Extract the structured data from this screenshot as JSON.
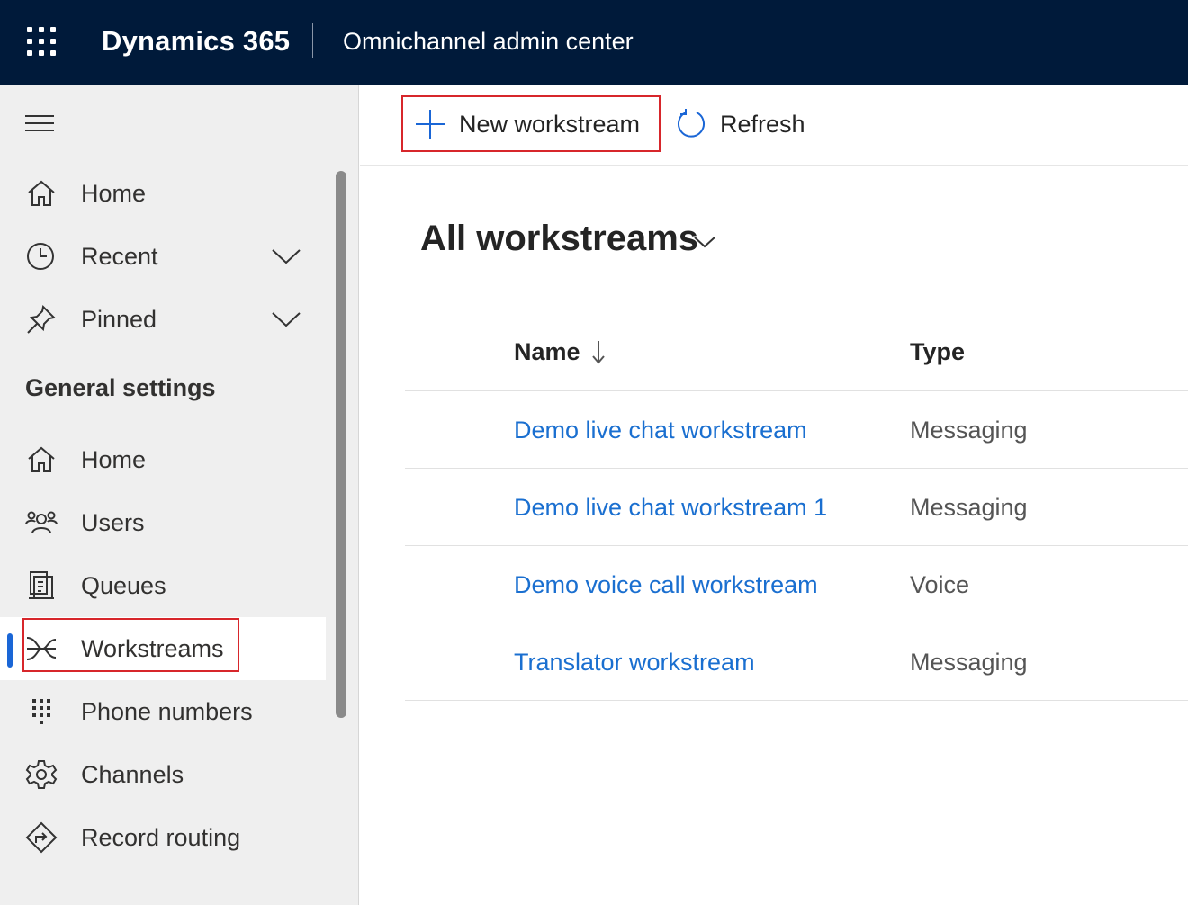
{
  "header": {
    "brand": "Dynamics 365",
    "app_name": "Omnichannel admin center"
  },
  "sidebar": {
    "top_items": [
      {
        "label": "Home",
        "icon": "home-icon"
      },
      {
        "label": "Recent",
        "icon": "clock-icon",
        "expandable": true
      },
      {
        "label": "Pinned",
        "icon": "pin-icon",
        "expandable": true
      }
    ],
    "section_title": "General settings",
    "items": [
      {
        "label": "Home",
        "icon": "home-icon"
      },
      {
        "label": "Users",
        "icon": "users-icon"
      },
      {
        "label": "Queues",
        "icon": "queues-icon"
      },
      {
        "label": "Workstreams",
        "icon": "workstreams-icon",
        "selected": true
      },
      {
        "label": "Phone numbers",
        "icon": "dialpad-icon"
      },
      {
        "label": "Channels",
        "icon": "gear-icon"
      },
      {
        "label": "Record routing",
        "icon": "routing-icon"
      }
    ]
  },
  "toolbar": {
    "new_label": "New workstream",
    "refresh_label": "Refresh"
  },
  "view": {
    "title": "All workstreams"
  },
  "table": {
    "columns": [
      "Name",
      "Type"
    ],
    "rows": [
      {
        "name": "Demo live chat workstream",
        "type": "Messaging"
      },
      {
        "name": "Demo live chat workstream 1",
        "type": "Messaging"
      },
      {
        "name": "Demo voice call workstream",
        "type": "Voice"
      },
      {
        "name": "Translator workstream",
        "type": "Messaging"
      }
    ]
  },
  "colors": {
    "header_bg": "#001a3a",
    "accent": "#1a66d6",
    "link": "#1a6fd0",
    "highlight_border": "#d7262b"
  }
}
